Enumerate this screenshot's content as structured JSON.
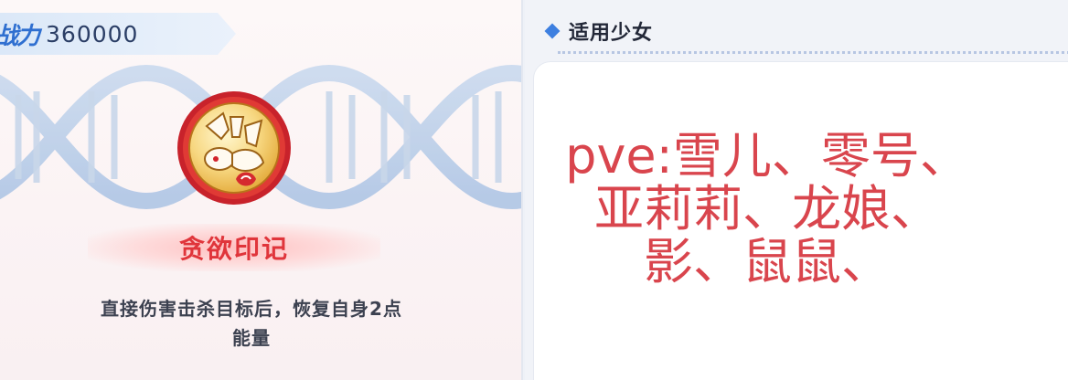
{
  "power": {
    "label": "战力",
    "value": "360000"
  },
  "skill": {
    "icon": "greed-mark-emblem-icon",
    "name": "贪欲印记",
    "description_line1": "直接伤害击杀目标后，恢复自身2点",
    "description_line2": "能量"
  },
  "applicable": {
    "header": "适用少女",
    "line1": "pve:雪儿、零号、",
    "line2": "亚莉莉、龙娘、",
    "line3": "影、鼠鼠、"
  },
  "colors": {
    "accent_blue": "#3d7fe0",
    "skill_name_red": "#e0353b",
    "recommend_red": "#d9454d",
    "power_value": "#2b3e66"
  }
}
